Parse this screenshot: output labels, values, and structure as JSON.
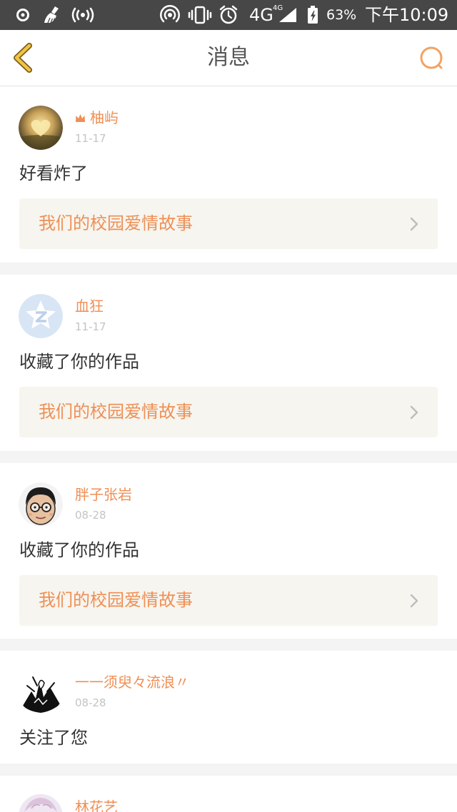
{
  "status_bar": {
    "network": "4G",
    "network_badge": "4G",
    "battery": "63%",
    "time": "下午10:09",
    "icons": [
      "circle-dot-icon",
      "broom-icon",
      "broadcast-icon",
      "hotspot-icon",
      "vibrate-icon",
      "alarm-icon",
      "signal-icon",
      "battery-charging-icon"
    ]
  },
  "header": {
    "title": "消息",
    "back_icon": "chevron-left-icon",
    "search_icon": "search-icon"
  },
  "colors": {
    "accent": "#ef8f55",
    "status_bar": "#474747",
    "back_chevron": "#f2c443",
    "search_icon": "#f3a261",
    "work_link_bg": "#f6f5ef",
    "date_text": "#c4c4c4",
    "message_text": "#333333"
  },
  "messages": [
    {
      "name": "柚屿",
      "badge_icon": "crown-icon",
      "date": "11-17",
      "text": "好看炸了",
      "work": "我们的校园爱情故事"
    },
    {
      "name": "血狂",
      "date": "11-17",
      "text": "收藏了你的作品",
      "work": "我们的校园爱情故事"
    },
    {
      "name": "胖子张岩",
      "date": "08-28",
      "text": "收藏了你的作品",
      "work": "我们的校园爱情故事"
    },
    {
      "name": "一一须臾々流浪〃",
      "date": "08-28",
      "text": "关注了您"
    },
    {
      "name": "林花艺"
    }
  ]
}
